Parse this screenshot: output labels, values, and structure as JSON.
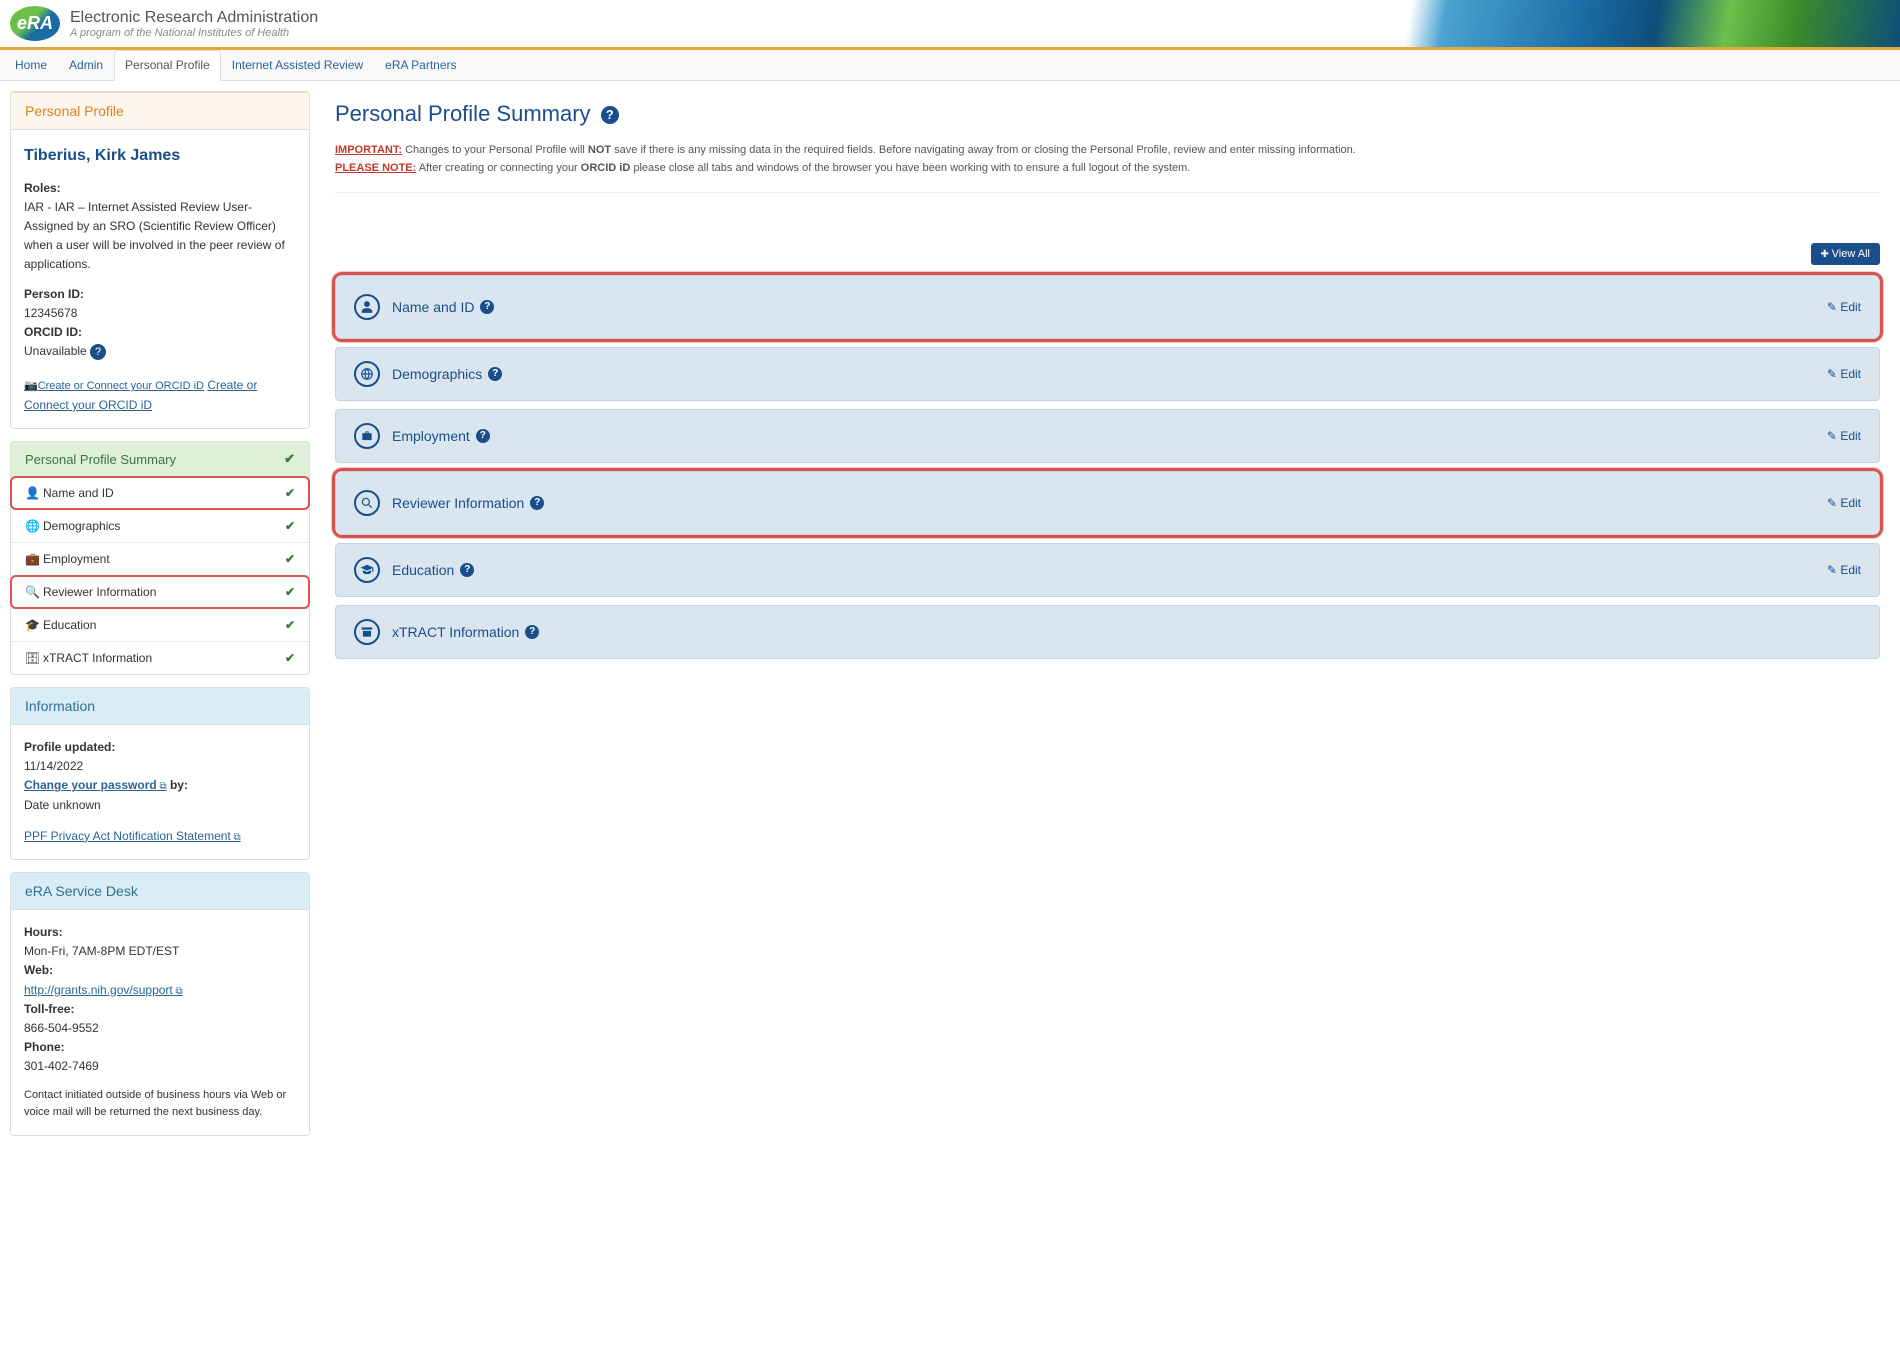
{
  "header": {
    "logo_text": "eRA",
    "title": "Electronic Research Administration",
    "subtitle": "A program of the National Institutes of Health"
  },
  "nav": {
    "home": "Home",
    "admin": "Admin",
    "personal_profile": "Personal Profile",
    "iar": "Internet Assisted Review",
    "partners": "eRA Partners"
  },
  "sidebar": {
    "profile_panel_title": "Personal Profile",
    "user_name": "Tiberius, Kirk James",
    "roles_label": "Roles:",
    "roles_text": "IAR - IAR – Internet Assisted Review User- Assigned by an SRO (Scientific Review Officer) when a user will be involved in the peer review of applications.",
    "person_id_label": "Person ID:",
    "person_id": "12345678",
    "orcid_label": "ORCID ID:",
    "orcid_value": "Unavailable",
    "orcid_img_alt": "Create or Connect your ORCID iD",
    "orcid_link": "Create or Connect your ORCID iD",
    "summary_header": "Personal Profile Summary",
    "items": {
      "name_id": "Name and ID",
      "demographics": "Demographics",
      "employment": "Employment",
      "reviewer": "Reviewer Information",
      "education": "Education",
      "xtract": "xTRACT Information"
    },
    "info_panel_title": "Information",
    "profile_updated_label": "Profile updated:",
    "profile_updated": "11/14/2022",
    "change_pw": "Change your password",
    "change_pw_by": " by:",
    "change_pw_date": "Date unknown",
    "ppf_link": "PPF Privacy Act Notification Statement",
    "service_desk_title": "eRA Service Desk",
    "hours_label": "Hours:",
    "hours": "Mon-Fri, 7AM-8PM EDT/EST",
    "web_label": "Web:",
    "web_link": "http://grants.nih.gov/support",
    "tollfree_label": "Toll-free:",
    "tollfree": "866-504-9552",
    "phone_label": "Phone:",
    "phone": "301-402-7469",
    "contact_note": "Contact initiated outside of business hours via Web or voice mail will be returned the next business day."
  },
  "main": {
    "title": "Personal Profile Summary",
    "important_label": "IMPORTANT:",
    "important_text_1": "  Changes to your Personal Profile will ",
    "important_not": "NOT",
    "important_text_2": " save if there is any missing data in the required fields. Before navigating away from or closing the Personal Profile, review and enter missing information.",
    "please_note_label": "PLEASE NOTE:",
    "please_note_1": " After creating or connecting your ",
    "please_note_orcid": "ORCID iD",
    "please_note_2": " please close all tabs and windows of the browser you have been working with to ensure a full logout of the system.",
    "view_all": "View All",
    "cards": {
      "name_id": "Name and ID",
      "demographics": "Demographics",
      "employment": "Employment",
      "reviewer": "Reviewer Information",
      "education": "Education",
      "xtract": "xTRACT Information",
      "edit": "Edit"
    }
  }
}
